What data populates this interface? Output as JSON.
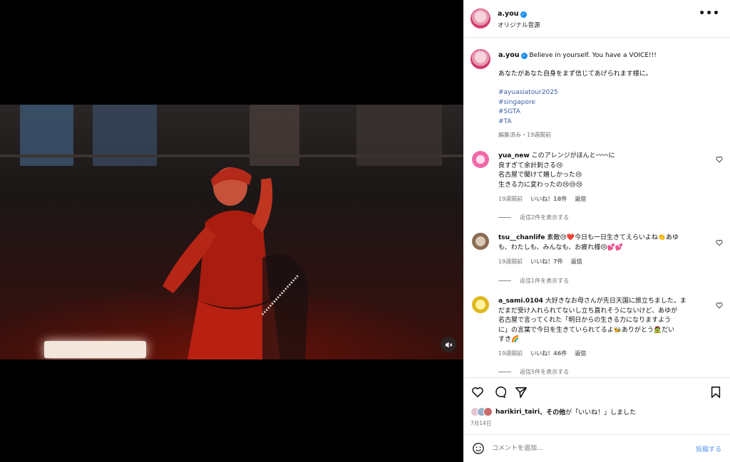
{
  "post": {
    "author": "a.you",
    "audio": "オリジナル音源",
    "more_label": "•••"
  },
  "caption": {
    "author": "a.you",
    "headline": "Believe in yourself. You have a VOICE!!!",
    "body": "あなたがあなた自身をまず信じてあげられます様に。",
    "hashtags": [
      "#ayuasiatour2025",
      "#singapore",
      "#SGTA",
      "#TA"
    ],
    "meta": "編集済み・19週間前"
  },
  "comments": [
    {
      "user": "yua_new",
      "lines": [
        "このアレンジがほんと〰〰に",
        "良すぎて余計刺さる😢",
        "名古屋で聞けて嬉しかった😢",
        "生きる力に変わったの😢😢😢"
      ],
      "time": "19週間前",
      "likes": "いいね！18件",
      "reply": "返信",
      "replies": "返信2件を表示する"
    },
    {
      "user": "tsu__chanlife",
      "lines": [
        "素敵😢❤️今日も一日生きてえらいよね👏あゆ",
        "も、わたしも、みんなも、お疲れ様😢💕💕"
      ],
      "time": "19週間前",
      "likes": "いいね！7件",
      "reply": "返信",
      "replies": "返信1件を表示する"
    },
    {
      "user": "a_sami.0104",
      "lines": [
        "大好きなお母さんが先日天国に旅立ちました。ま",
        "だまだ受け入れられてないし立ち直れそうにないけど、あゆが",
        "名古屋で言ってくれた「明日からの生きる力になりますよう",
        "に」の言葉で今日を生きていられてるよ🐝ありがとう🧟だい",
        "すき🌈"
      ],
      "time": "19週間前",
      "likes": "いいね！46件",
      "reply": "返信",
      "replies": "返信5件を表示する"
    }
  ],
  "actions": {
    "liked_by_user": "harikiri_tairi",
    "liked_by_rest": "、その他",
    "liked_by_suffix": "が「いいね！」しました",
    "date": "7月14日"
  },
  "composer": {
    "placeholder": "コメントを追加...",
    "post_label": "投稿する"
  },
  "colors": {
    "link": "#3a5fa8",
    "verified": "#1a8cf2",
    "post_disabled": "#8fb9f2"
  }
}
